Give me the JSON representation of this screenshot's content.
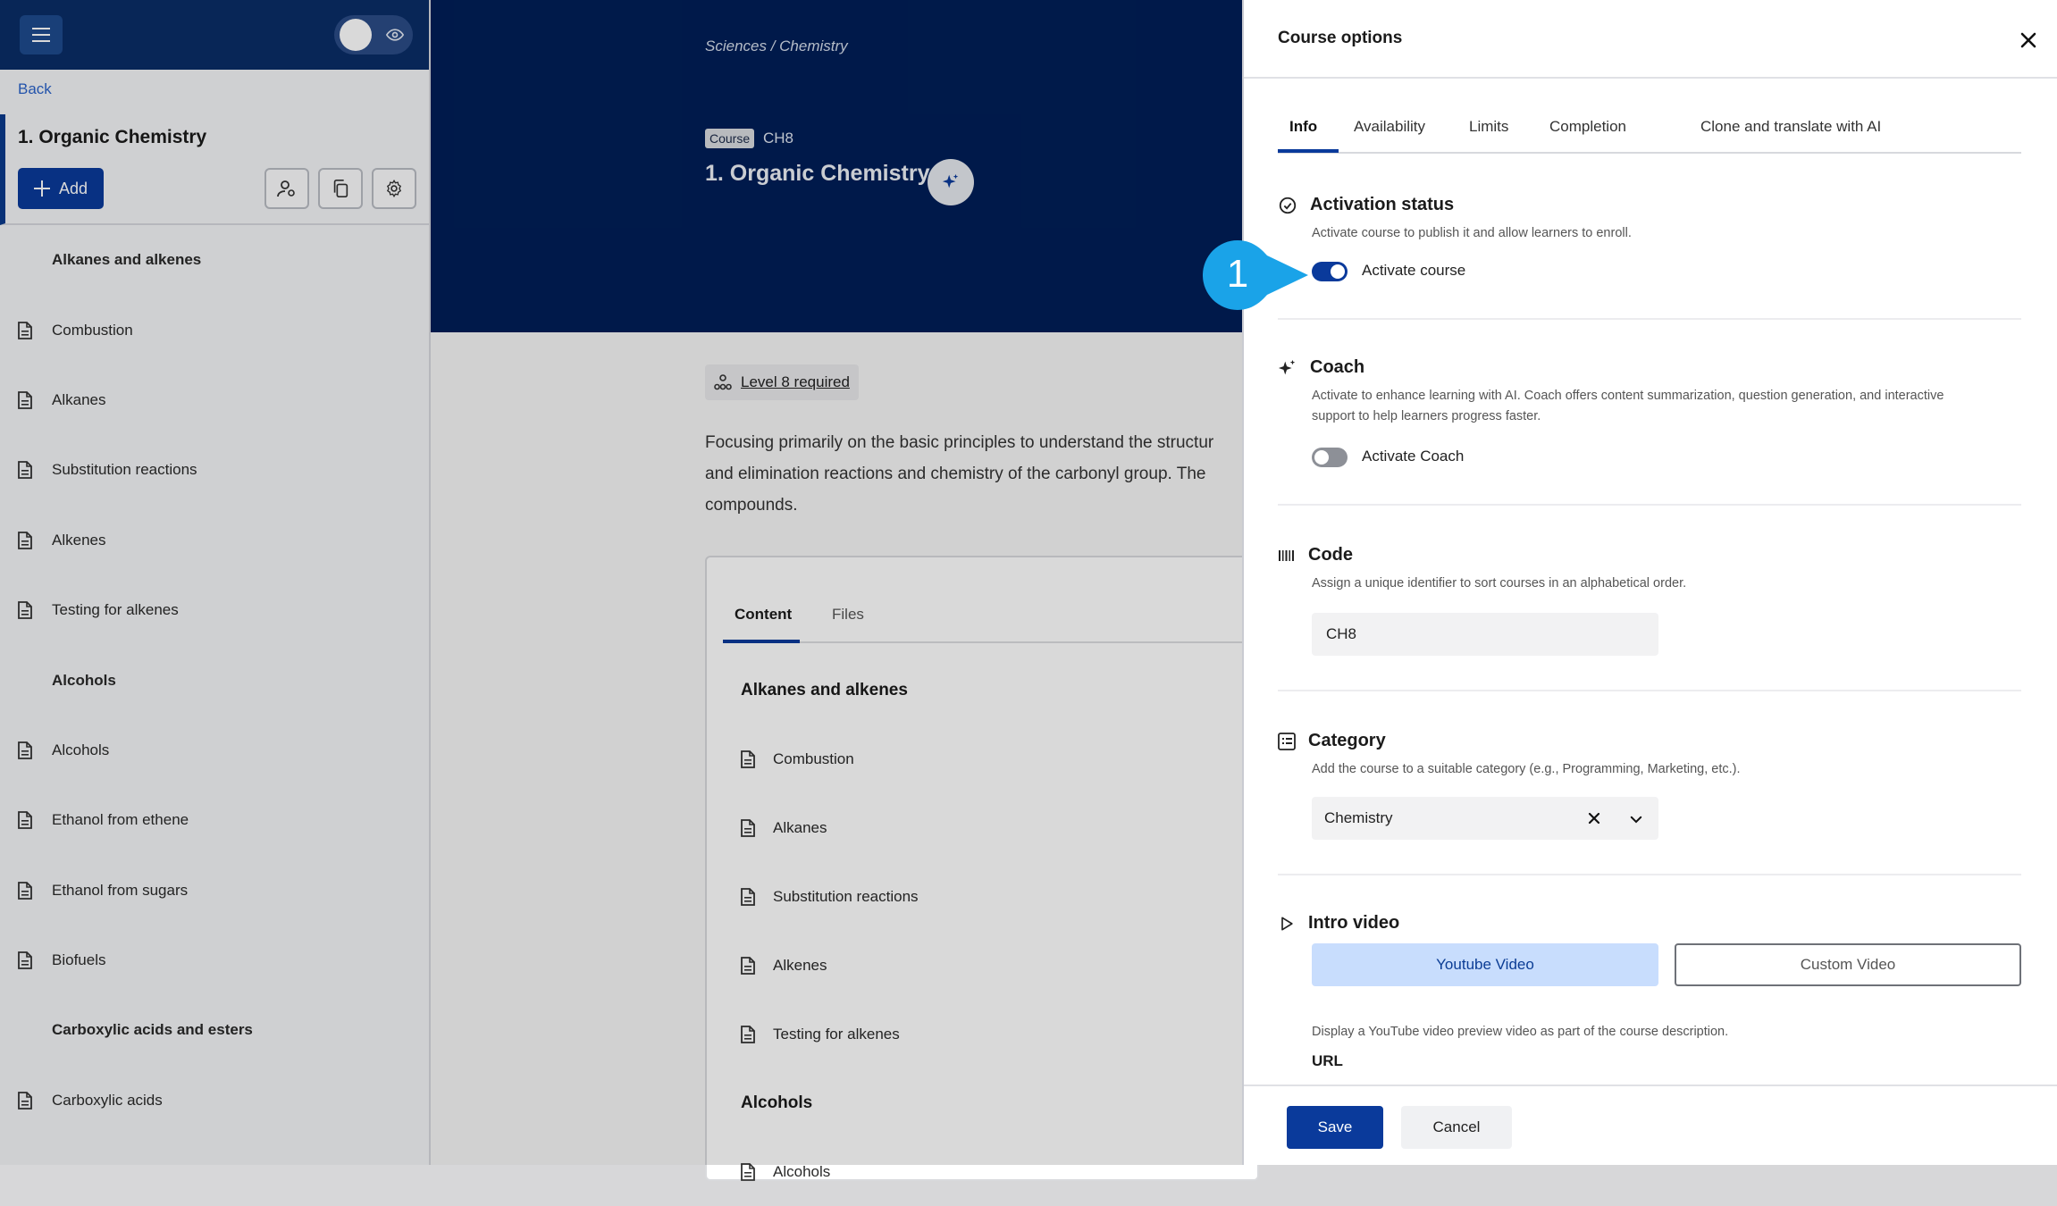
{
  "sidebar": {
    "back": "Back",
    "course_title": "1. Organic Chemistry",
    "add_label": "Add",
    "items": [
      {
        "type": "section",
        "label": "Alkanes and alkenes"
      },
      {
        "type": "unit",
        "label": "Combustion"
      },
      {
        "type": "unit",
        "label": "Alkanes"
      },
      {
        "type": "unit",
        "label": "Substitution reactions"
      },
      {
        "type": "unit",
        "label": "Alkenes"
      },
      {
        "type": "unit",
        "label": "Testing for alkenes"
      },
      {
        "type": "section",
        "label": "Alcohols"
      },
      {
        "type": "unit",
        "label": "Alcohols"
      },
      {
        "type": "unit",
        "label": "Ethanol from ethene"
      },
      {
        "type": "unit",
        "label": "Ethanol from sugars"
      },
      {
        "type": "unit",
        "label": "Biofuels"
      },
      {
        "type": "section",
        "label": "Carboxylic acids and esters"
      },
      {
        "type": "unit",
        "label": "Carboxylic acids"
      }
    ]
  },
  "main": {
    "breadcrumb": "Sciences / Chemistry",
    "badge": "Course",
    "code": "CH8",
    "title": "1. Organic Chemistry",
    "level": "Level 8 required",
    "description": "Focusing primarily on the basic principles to understand the structur\nand elimination reactions and chemistry of the carbonyl group. The\ncompounds.",
    "tabs": {
      "content": "Content",
      "files": "Files"
    },
    "list": [
      {
        "type": "section",
        "label": "Alkanes and alkenes"
      },
      {
        "type": "unit",
        "label": "Combustion"
      },
      {
        "type": "unit",
        "label": "Alkanes"
      },
      {
        "type": "unit",
        "label": "Substitution reactions"
      },
      {
        "type": "unit",
        "label": "Alkenes"
      },
      {
        "type": "unit",
        "label": "Testing for alkenes"
      },
      {
        "type": "section",
        "label": "Alcohols"
      },
      {
        "type": "unit",
        "label": "Alcohols"
      }
    ]
  },
  "panel": {
    "title": "Course options",
    "tabs": {
      "info": "Info",
      "availability": "Availability",
      "limits": "Limits",
      "completion": "Completion",
      "clone": "Clone and translate with AI"
    },
    "activation": {
      "title": "Activation status",
      "desc": "Activate course to publish it and allow learners to enroll.",
      "toggle_label": "Activate course",
      "on": true
    },
    "coach": {
      "title": "Coach",
      "desc": "Activate to enhance learning with AI. Coach offers content summarization, question generation, and interactive\nsupport to help learners progress faster.",
      "toggle_label": "Activate Coach",
      "on": false
    },
    "code": {
      "title": "Code",
      "desc": "Assign a unique identifier to sort courses in an alphabetical order.",
      "value": "CH8"
    },
    "category": {
      "title": "Category",
      "desc": "Add the course to a suitable category (e.g., Programming, Marketing, etc.).",
      "value": "Chemistry"
    },
    "intro": {
      "title": "Intro video",
      "youtube": "Youtube Video",
      "custom": "Custom Video",
      "desc": "Display a YouTube video preview video as part of the course description.",
      "url_label": "URL"
    },
    "save": "Save",
    "cancel": "Cancel"
  },
  "callout": {
    "number": "1"
  },
  "colors": {
    "brand": "#0a3a9b",
    "hero": "#001e57",
    "callout": "#1aa3e8",
    "toggle_on": "#0a3a9b",
    "toggle_off": "#8d9097"
  }
}
